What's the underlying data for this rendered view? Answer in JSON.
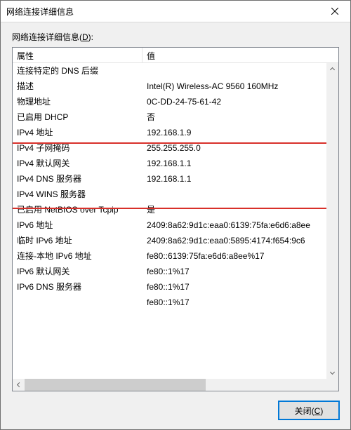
{
  "titlebar": {
    "title": "网络连接详细信息"
  },
  "label": {
    "prefix": "网络连接详细信息(",
    "underline": "D",
    "suffix": "):"
  },
  "columns": {
    "property": "属性",
    "value": "值"
  },
  "rows": [
    {
      "property": "连接特定的 DNS 后缀",
      "value": ""
    },
    {
      "property": "描述",
      "value": "Intel(R) Wireless-AC 9560 160MHz"
    },
    {
      "property": "物理地址",
      "value": "0C-DD-24-75-61-42"
    },
    {
      "property": "已启用 DHCP",
      "value": "否"
    },
    {
      "property": "IPv4 地址",
      "value": "192.168.1.9"
    },
    {
      "property": "IPv4 子网掩码",
      "value": "255.255.255.0"
    },
    {
      "property": "IPv4 默认网关",
      "value": "192.168.1.1"
    },
    {
      "property": "IPv4 DNS 服务器",
      "value": "192.168.1.1"
    },
    {
      "property": "IPv4 WINS 服务器",
      "value": ""
    },
    {
      "property": "已启用 NetBIOS over Tcpip",
      "value": "是"
    },
    {
      "property": "IPv6 地址",
      "value": "2409:8a62:9d1c:eaa0:6139:75fa:e6d6:a8ee"
    },
    {
      "property": "临时 IPv6 地址",
      "value": "2409:8a62:9d1c:eaa0:5895:4174:f654:9c6"
    },
    {
      "property": "连接-本地 IPv6 地址",
      "value": "fe80::6139:75fa:e6d6:a8ee%17"
    },
    {
      "property": "IPv6 默认网关",
      "value": "fe80::1%17"
    },
    {
      "property": "IPv6 DNS 服务器",
      "value": "fe80::1%17"
    },
    {
      "property": "",
      "value": "fe80::1%17"
    }
  ],
  "footer": {
    "close_prefix": "关闭(",
    "close_underline": "C",
    "close_suffix": ")"
  },
  "highlight": {
    "color": "#d8302a"
  }
}
